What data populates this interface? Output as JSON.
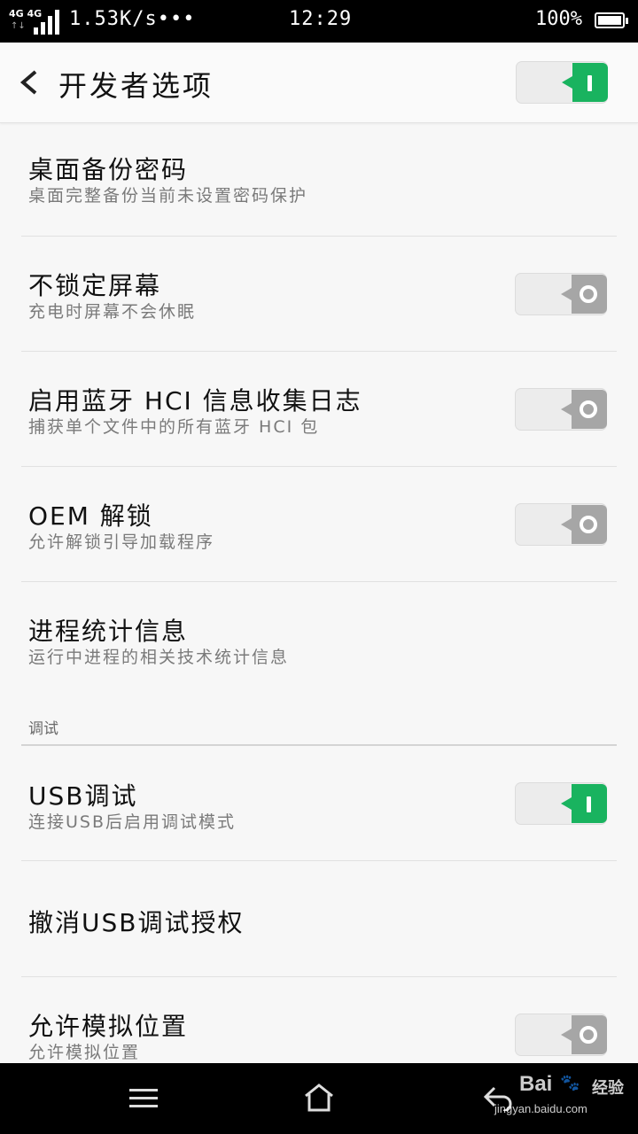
{
  "status_bar": {
    "network": "4G 4G",
    "arrows": "↑↓",
    "speed": "1.53K/s•••",
    "time": "12:29",
    "battery": "100%"
  },
  "header": {
    "title": "开发者选项",
    "master_switch_on": true
  },
  "items": [
    {
      "title": "桌面备份密码",
      "subtitle": "桌面完整备份当前未设置密码保护"
    },
    {
      "title": "不锁定屏幕",
      "subtitle": "充电时屏幕不会休眠",
      "switch_on": false
    },
    {
      "title": "启用蓝牙 HCI 信息收集日志",
      "subtitle": "捕获单个文件中的所有蓝牙 HCI 包",
      "switch_on": false
    },
    {
      "title": "OEM 解锁",
      "subtitle": "允许解锁引导加载程序",
      "switch_on": false
    },
    {
      "title": "进程统计信息",
      "subtitle": "运行中进程的相关技术统计信息"
    },
    {
      "title": "USB调试",
      "subtitle": "连接USB后启用调试模式",
      "switch_on": true
    },
    {
      "title": "撤消USB调试授权"
    },
    {
      "title": "允许模拟位置",
      "subtitle": "允许模拟位置",
      "switch_on": false
    }
  ],
  "section_debug": "调试",
  "watermark": {
    "logo": "Bai",
    "paw": "🐾",
    "jingyan": "经验",
    "url": "jingyan.baidu.com"
  },
  "colors": {
    "switch_on": "#19b35f",
    "switch_off": "#a6a6a6",
    "background": "#f7f7f7"
  }
}
